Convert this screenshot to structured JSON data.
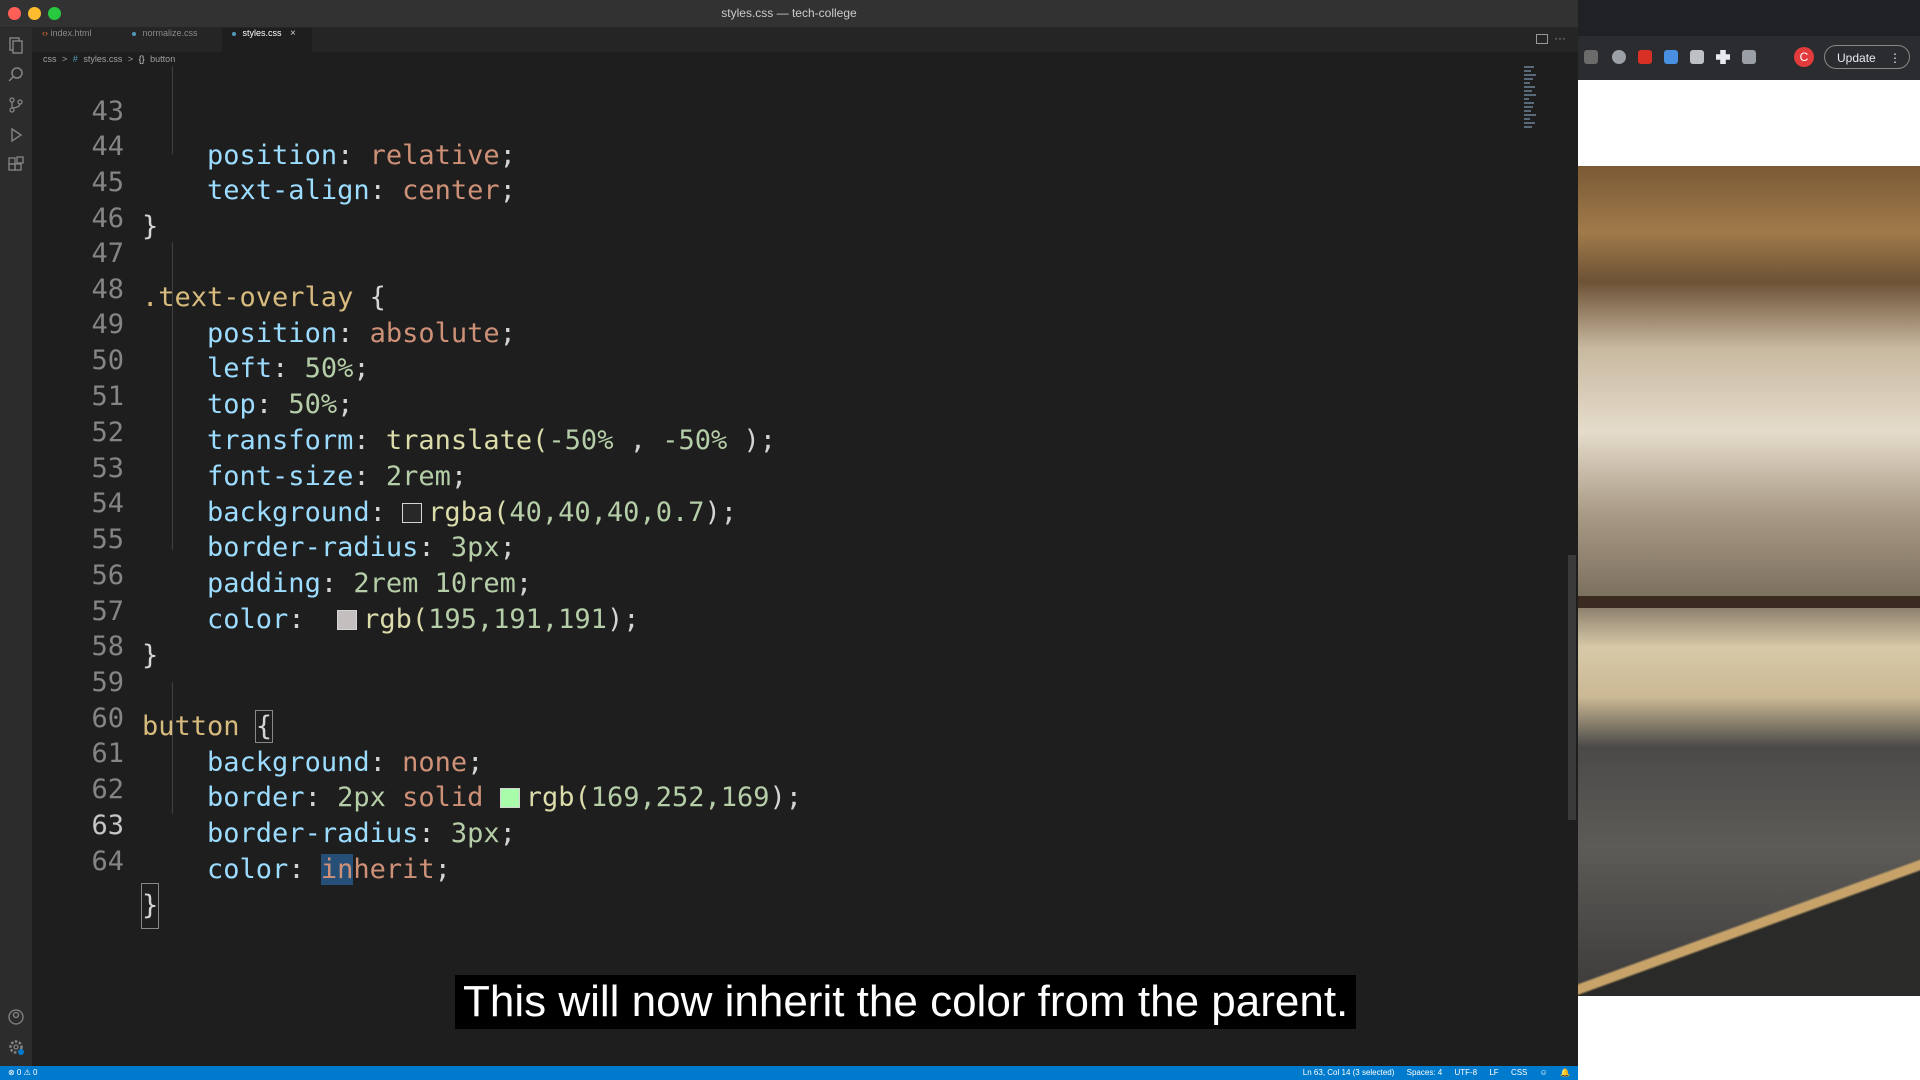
{
  "window": {
    "title": "styles.css — tech-college"
  },
  "tabs": [
    {
      "label": "index.html",
      "icon": "html-icon",
      "active": false
    },
    {
      "label": "normalize.css",
      "icon": "css-icon",
      "active": false
    },
    {
      "label": "styles.css",
      "icon": "css-icon",
      "active": true,
      "close": "×"
    }
  ],
  "breadcrumb": {
    "folder": "css",
    "sep1": ">",
    "file": "styles.css",
    "sep2": ">",
    "symbol": "button"
  },
  "code": {
    "line_numbers": [
      "43",
      "44",
      "45",
      "46",
      "47",
      "48",
      "49",
      "50",
      "51",
      "52",
      "53",
      "54",
      "55",
      "56",
      "57",
      "58",
      "59",
      "60",
      "61",
      "62",
      "63",
      "64"
    ],
    "current_line": "63",
    "l43": {
      "prop": "position",
      "val": "relative"
    },
    "l44": {
      "prop": "text-align",
      "val": "center"
    },
    "l45": {
      "brace": "}"
    },
    "l47": {
      "selector": ".text-overlay",
      "brace": "{"
    },
    "l48": {
      "prop": "position",
      "val": "absolute"
    },
    "l49": {
      "prop": "left",
      "val": "50%"
    },
    "l50": {
      "prop": "top",
      "val": "50%"
    },
    "l51": {
      "prop": "transform",
      "fn": "translate(",
      "a": "-50%",
      "comma": " , ",
      "b": "-50%",
      "close": " );"
    },
    "l52": {
      "prop": "font-size",
      "val": "2rem"
    },
    "l53": {
      "prop": "background",
      "fn": "rgba(",
      "args": "40,40,40,0.7",
      "close": ");",
      "swatch": "#282828"
    },
    "l54": {
      "prop": "border-radius",
      "val": "3px"
    },
    "l55": {
      "prop": "padding",
      "val": "2rem 10rem"
    },
    "l56": {
      "prop": "color",
      "fn": "rgb(",
      "args": "195,191,191",
      "close": ");",
      "swatch": "#c3bfbf"
    },
    "l57": {
      "brace": "}"
    },
    "l59": {
      "selector": "button",
      "brace": "{"
    },
    "l60": {
      "prop": "background",
      "val": "none"
    },
    "l61": {
      "prop": "border",
      "v1": "2px",
      "v2": "solid",
      "fn": "rgb(",
      "args": "169,252,169",
      "close": ");",
      "swatch": "#a9fca9"
    },
    "l62": {
      "prop": "border-radius",
      "val": "3px"
    },
    "l63": {
      "prop": "color",
      "sel": "in",
      "rest": "herit"
    },
    "l64": {
      "brace": "}"
    }
  },
  "statusbar": {
    "left": "⊗ 0  ⚠ 0",
    "position": "Ln 63, Col 14 (3 selected)",
    "spaces": "Spaces: 4",
    "encoding": "UTF-8",
    "eol": "LF",
    "language": "CSS"
  },
  "browser": {
    "profile_initial": "C",
    "update_label": "Update",
    "menu": "⋮"
  },
  "caption": "This will now inherit the color from the parent.",
  "colors": {
    "editor_bg": "#1e1e1e",
    "statusbar": "#007acc",
    "property": "#9cdcfe",
    "string_value": "#ce9178",
    "number": "#b5cea8",
    "selector": "#d7ba7d"
  }
}
